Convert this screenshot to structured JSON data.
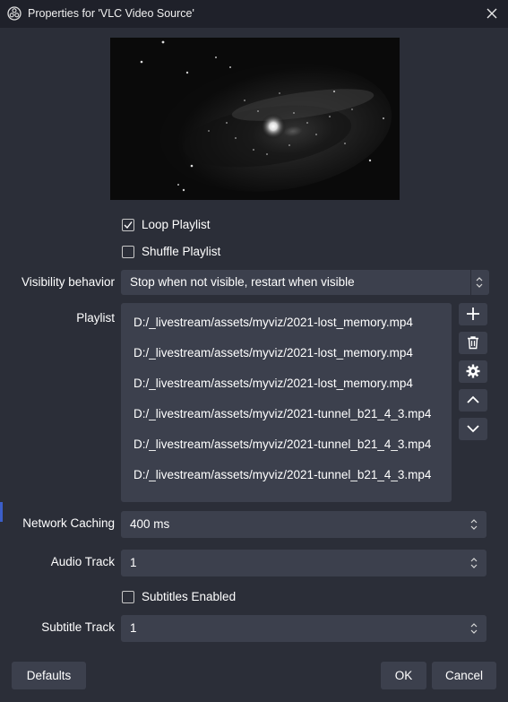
{
  "window": {
    "title": "Properties for 'VLC Video Source'"
  },
  "icons": {
    "app": "obs-logo-icon",
    "close": "close-icon",
    "add": "plus-icon",
    "remove": "trash-icon",
    "configure": "gear-icon",
    "move_up": "chevron-up-icon",
    "move_down": "chevron-down-icon",
    "spin": "spin-arrows-icon"
  },
  "colors": {
    "background": "#2b2e38",
    "titlebar": "#1f212a",
    "control": "#3c404d",
    "text": "#ffffff"
  },
  "options": {
    "loop_playlist": {
      "label": "Loop Playlist",
      "checked": true
    },
    "shuffle_playlist": {
      "label": "Shuffle Playlist",
      "checked": false
    }
  },
  "visibility": {
    "label": "Visibility behavior",
    "value": "Stop when not visible, restart when visible"
  },
  "playlist": {
    "label": "Playlist",
    "items": [
      "D:/_livestream/assets/myviz/2021-lost_memory.mp4",
      "D:/_livestream/assets/myviz/2021-lost_memory.mp4",
      "D:/_livestream/assets/myviz/2021-lost_memory.mp4",
      "D:/_livestream/assets/myviz/2021-tunnel_b21_4_3.mp4",
      "D:/_livestream/assets/myviz/2021-tunnel_b21_4_3.mp4",
      "D:/_livestream/assets/myviz/2021-tunnel_b21_4_3.mp4"
    ]
  },
  "network_caching": {
    "label": "Network Caching",
    "value": "400 ms"
  },
  "audio_track": {
    "label": "Audio Track",
    "value": "1"
  },
  "subtitles": {
    "label": "Subtitles Enabled",
    "checked": false
  },
  "subtitle_track": {
    "label": "Subtitle Track",
    "value": "1"
  },
  "buttons": {
    "defaults": "Defaults",
    "ok": "OK",
    "cancel": "Cancel"
  }
}
